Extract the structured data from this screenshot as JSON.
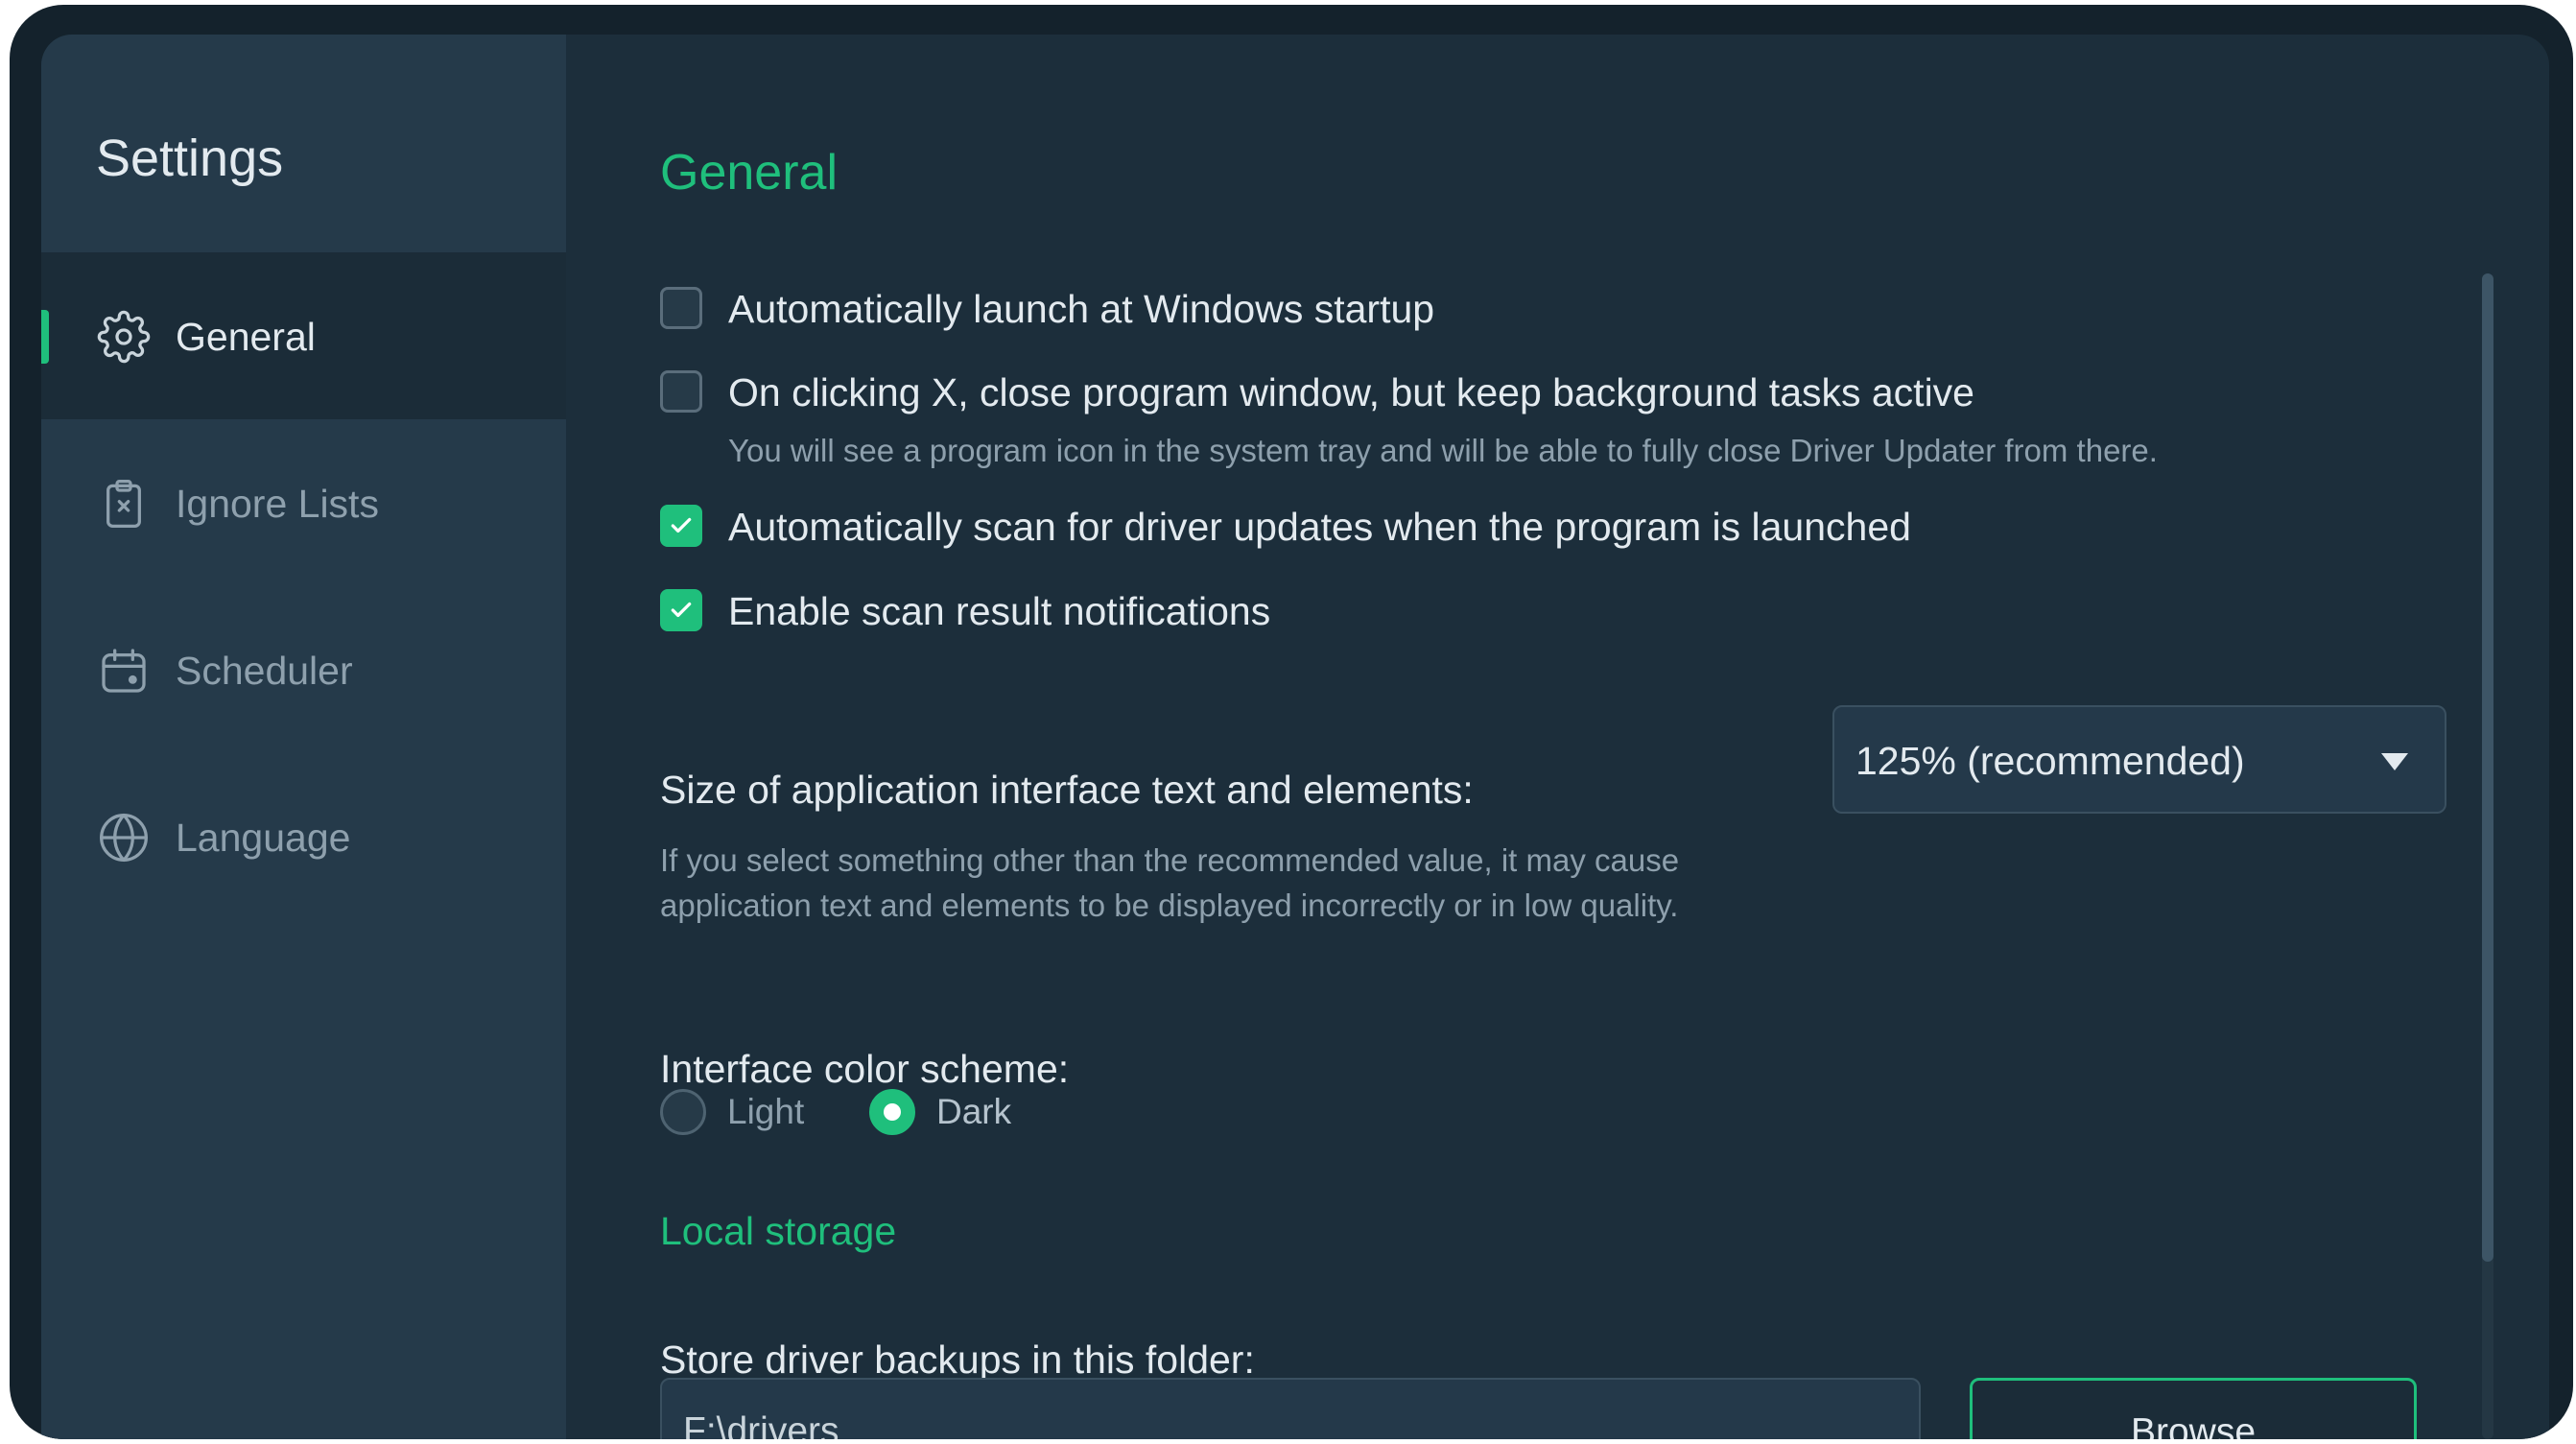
{
  "sidebar": {
    "title": "Settings",
    "items": [
      {
        "label": "General",
        "icon": "gear-icon",
        "active": true
      },
      {
        "label": "Ignore Lists",
        "icon": "clipboard-x-icon",
        "active": false
      },
      {
        "label": "Scheduler",
        "icon": "calendar-icon",
        "active": false
      },
      {
        "label": "Language",
        "icon": "globe-icon",
        "active": false
      }
    ]
  },
  "main": {
    "title": "General",
    "options": [
      {
        "label": "Automatically launch at Windows startup",
        "checked": false
      },
      {
        "label": "On clicking X, close program window, but keep background tasks active",
        "checked": false,
        "hint": "You will see a program icon in the system tray and will be able to fully close Driver Updater from there."
      },
      {
        "label": "Automatically scan for driver updates when the program is launched",
        "checked": true
      },
      {
        "label": "Enable scan result notifications",
        "checked": true
      }
    ],
    "ui_size": {
      "label": "Size of application interface text and elements:",
      "hint": "If you select something other than the recommended value, it may cause application text and elements to be displayed incorrectly or in low quality.",
      "value": "125% (recommended)"
    },
    "color_scheme": {
      "label": "Interface color scheme:",
      "options": [
        {
          "label": "Light",
          "selected": false
        },
        {
          "label": "Dark",
          "selected": true
        }
      ]
    },
    "local_storage": {
      "title": "Local storage",
      "label": "Store driver backups in this folder:",
      "path": "F:\\drivers",
      "browse_label": "Browse"
    }
  },
  "colors": {
    "accent": "#1fbf7c",
    "background": "#1c2e3b",
    "sidebar": "#253a4a"
  }
}
